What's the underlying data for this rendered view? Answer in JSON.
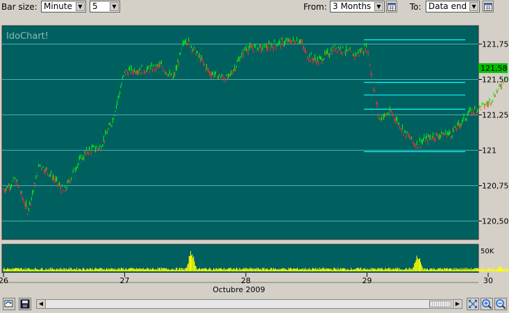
{
  "toolbar": {
    "bar_size_label": "Bar size:",
    "bar_size_value": "Minute",
    "bar_count_value": "5",
    "from_label": "From:",
    "from_value": "3 Months",
    "to_label": "To:",
    "to_value": "Data end"
  },
  "chart": {
    "watermark": "IdoChart!",
    "background": "#006060",
    "price_axis_labels": [
      "121,75",
      "121,50",
      "121,25",
      "121",
      "120,75",
      "120,50"
    ],
    "current_price": "121,58",
    "current_price_color": "#00c000",
    "volume_label": "50K",
    "x_axis_labels": [
      "26",
      "27",
      "28",
      "29",
      "30"
    ],
    "month_label": "Octubre 2009",
    "up_color": "#00ff00",
    "down_color": "#ff3030",
    "volume_color": "#ffff00",
    "fib_line_color": "#00ffff"
  },
  "chart_data": {
    "type": "line",
    "title": "",
    "xlabel": "Octubre 2009",
    "ylabel": "",
    "ylim": [
      120.37,
      121.88
    ],
    "x": [
      26.0,
      26.1,
      26.2,
      26.3,
      26.4,
      26.5,
      26.6,
      26.7,
      26.8,
      26.9,
      27.0,
      27.1,
      27.2,
      27.3,
      27.4,
      27.5,
      27.55,
      27.7,
      27.85,
      28.0,
      28.15,
      28.3,
      28.45,
      28.5,
      28.6,
      28.75,
      28.9,
      29.0,
      29.1,
      29.2,
      29.3,
      29.4,
      29.45,
      29.55,
      29.7,
      29.85,
      30.0,
      30.1,
      30.17
    ],
    "values": [
      120.72,
      120.79,
      120.57,
      120.9,
      120.82,
      120.7,
      120.89,
      121.0,
      121.02,
      121.21,
      121.55,
      121.57,
      121.57,
      121.6,
      121.5,
      121.79,
      121.74,
      121.55,
      121.5,
      121.72,
      121.72,
      121.76,
      121.78,
      121.67,
      121.63,
      121.73,
      121.67,
      121.73,
      121.22,
      121.27,
      121.14,
      121.04,
      121.06,
      121.1,
      121.12,
      121.27,
      121.33,
      121.45,
      121.58
    ],
    "volume_peaks": [
      {
        "x": 27.55,
        "volume": 50000
      },
      {
        "x": 29.42,
        "volume": 40000
      },
      {
        "x": 30.1,
        "volume": 12000
      }
    ],
    "horizontal_lines": [
      121.78,
      121.48,
      121.39,
      121.29,
      120.99
    ]
  },
  "status": {
    "refresh_icon": "refresh-icon",
    "save_icon": "save-icon"
  }
}
